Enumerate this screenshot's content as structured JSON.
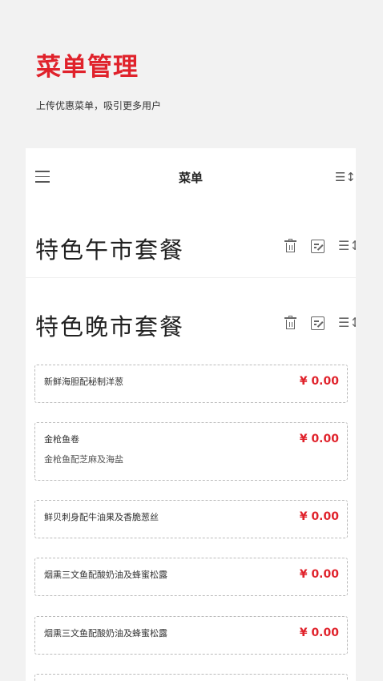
{
  "header": {
    "title": "菜单管理",
    "subtitle": "上传优惠菜单，吸引更多用户"
  },
  "topbar": {
    "title": "菜单",
    "menu_icon": "hamburger-icon",
    "sort_icon": "sort-icon",
    "sort_glyph": "☰↕"
  },
  "sections": [
    {
      "title": "特色午市套餐"
    },
    {
      "title": "特色晚市套餐"
    }
  ],
  "items": [
    {
      "name": "新鲜海胆配秘制洋葱",
      "desc": "",
      "price": "¥ 0.00"
    },
    {
      "name": "金枪鱼卷",
      "desc": "金枪鱼配芝麻及海盐",
      "price": "¥ 0.00"
    },
    {
      "name": "鲜贝刺身配牛油果及香脆葱丝",
      "desc": "",
      "price": "¥ 0.00"
    },
    {
      "name": "烟熏三文鱼配酸奶油及蜂蜜松露",
      "desc": "",
      "price": "¥ 0.00"
    },
    {
      "name": "烟熏三文鱼配酸奶油及蜂蜜松露",
      "desc": "",
      "price": "¥ 0.00"
    }
  ],
  "colors": {
    "accent": "#e0222b",
    "background": "#f2f2f2",
    "card": "#ffffff"
  }
}
